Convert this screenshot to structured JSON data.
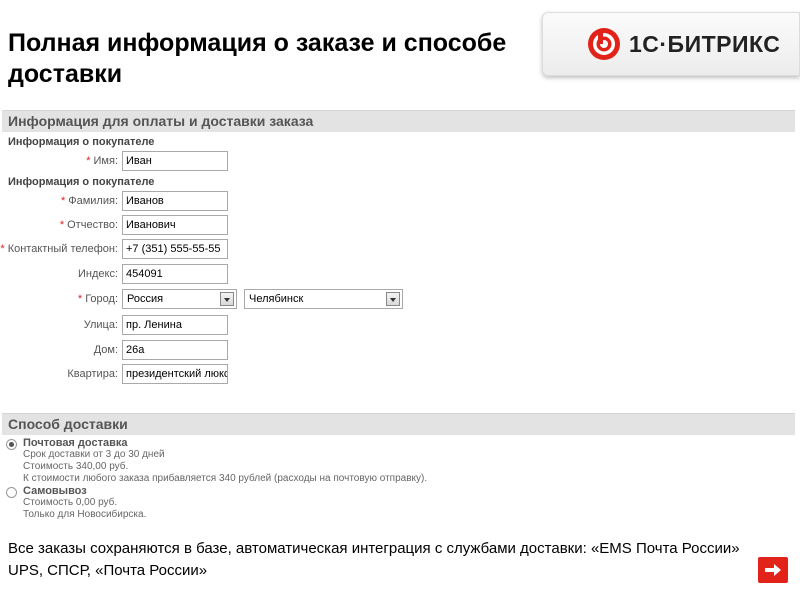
{
  "slide": {
    "title": "Полная информация о заказе и способе доставки",
    "brand": {
      "name": "1С·БИТРИКС",
      "mark_color": "#e2231a"
    },
    "footer": "Все заказы сохраняются в базе, автоматическая интеграция с службами доставки: «EMS Почта России» UPS, СПСР, «Почта России»"
  },
  "order_form": {
    "section_title": "Информация для оплаты и доставки заказа",
    "buyer_heading_1": "Информация о покупателе",
    "buyer_heading_2": "Информация о покупателе",
    "fields": {
      "name": {
        "label": "Имя:",
        "required": "*",
        "value": "Иван"
      },
      "surname": {
        "label": "Фамилия:",
        "required": "*",
        "value": "Иванов"
      },
      "patronymic": {
        "label": "Отчество:",
        "required": "*",
        "value": "Иванович"
      },
      "phone": {
        "label": "Контактный телефон:",
        "required": "*",
        "value": "+7 (351) 555-55-55"
      },
      "zip": {
        "label": "Индекс:",
        "value": "454091"
      },
      "city": {
        "label": "Город:",
        "required": "*",
        "country": "Россия",
        "city": "Челябинск"
      },
      "street": {
        "label": "Улица:",
        "value": "пр. Ленина"
      },
      "house": {
        "label": "Дом:",
        "value": "26а"
      },
      "apartment": {
        "label": "Квартира:",
        "value": "президентский люкс"
      }
    }
  },
  "delivery": {
    "section_title": "Способ доставки",
    "options": [
      {
        "name": "Почтовая доставка",
        "selected": true,
        "lines": [
          "Срок доставки от 3 до 30 дней",
          "Стоимость 340,00 руб.",
          "К стоимости любого заказа прибавляется 340 рублей (расходы на почтовую отправку)."
        ]
      },
      {
        "name": "Самовывоз",
        "selected": false,
        "lines": [
          "Стоимость 0,00 руб.",
          "Только для Новосибирска."
        ]
      }
    ]
  },
  "colors": {
    "accent": "#e2231a",
    "section_bar": "#e3e3e3",
    "required_star": "#e02020"
  }
}
